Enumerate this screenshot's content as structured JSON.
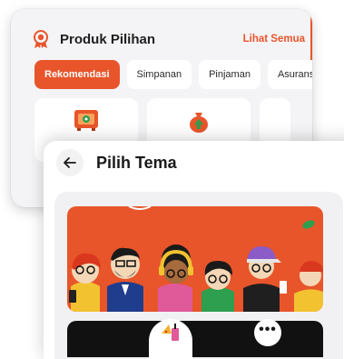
{
  "produk": {
    "title": "Produk Pilihan",
    "see_all": "Lihat Semua",
    "tabs": [
      "Rekomendasi",
      "Simpanan",
      "Pinjaman",
      "Asuransi"
    ],
    "active_tab": "Rekomendasi"
  },
  "tema": {
    "title": "Pilih Tema"
  },
  "colors": {
    "accent": "#e8552b",
    "card_bg": "#f4f4f6",
    "bar": "#111111"
  },
  "icons": {
    "back": "arrow-left-icon",
    "medal": "medal-icon",
    "more": "more-icon"
  }
}
